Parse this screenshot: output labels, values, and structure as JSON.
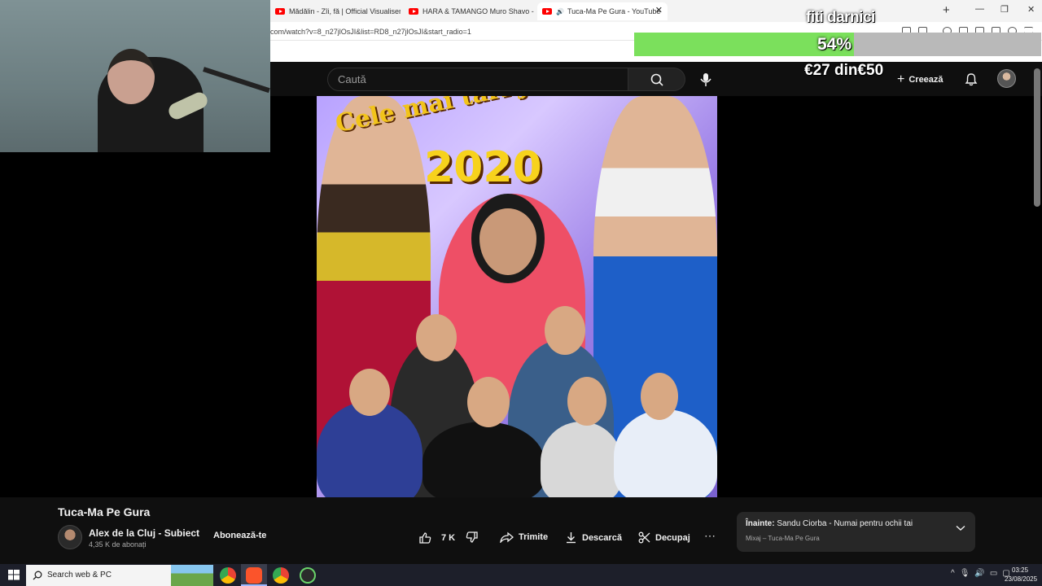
{
  "browser": {
    "tabs": [
      {
        "title": "Mădălin - Zîi, fă | Official Visualiser - Y",
        "active": false
      },
      {
        "title": "HARA & TAMANGO Muro Shavo - Yo",
        "active": false
      },
      {
        "title": "Tuca-Ma Pe Gura - YouTube",
        "active": true
      }
    ],
    "url": "com/watch?v=8_n27jlOsJI&list=RD8_n27jlOsJI&start_radio=1",
    "new_tab": "+",
    "close_tab": "✕",
    "window_controls": {
      "minimize": "—",
      "restore": "❐",
      "close": "✕"
    }
  },
  "donation": {
    "title": "fiti darnici",
    "percent_label": "54%",
    "progress": 0.54,
    "amount": "€27 din€50",
    "fill_color": "#7be05c",
    "track_color": "#b9b9b9"
  },
  "masthead": {
    "search_placeholder": "Caută",
    "create_label": "Creează",
    "icons": [
      "keyboard-icon",
      "search-icon",
      "mic-icon",
      "plus-icon",
      "bell-icon"
    ]
  },
  "thumbnail": {
    "line1": "Cele mai tari jocuri țigănești",
    "line2": "2020"
  },
  "video": {
    "title": "Tuca-Ma Pe Gura",
    "channel_name": "Alex de la Cluj - Subiect",
    "subscribers": "4,35 K de abonați",
    "subscribe_label": "Abonează-te",
    "likes": "7 K",
    "share_label": "Trimite",
    "download_label": "Descarcă",
    "clip_label": "Decupaj",
    "more_label": "⋯"
  },
  "up_next": {
    "prefix": "Înainte:",
    "title": "Sandu Ciorba - Numai pentru ochii tai",
    "subtitle": "Mixaj – Tuca-Ma Pe Gura"
  },
  "taskbar": {
    "search_text": "Search web & PC",
    "time": "03:25",
    "date": "23/08/2025"
  },
  "colors": {
    "yt_bg": "#0f0f0f",
    "brand_red": "#ff0000"
  }
}
